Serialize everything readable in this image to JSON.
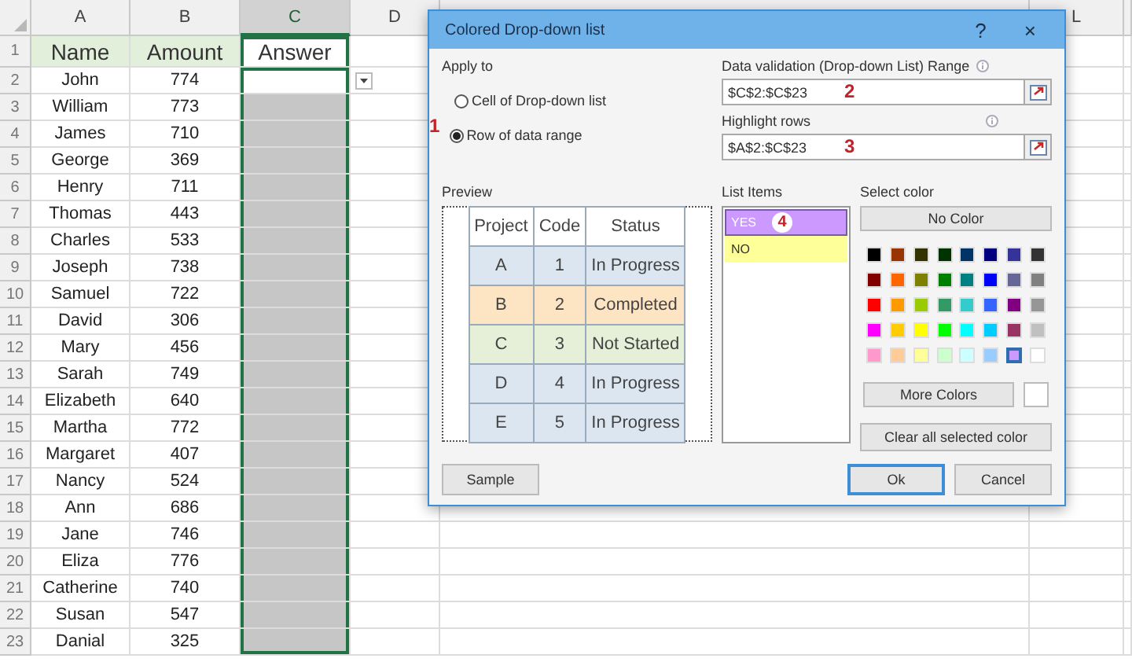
{
  "sheet": {
    "columns": [
      {
        "label": "A",
        "selected": false
      },
      {
        "label": "B",
        "selected": false
      },
      {
        "label": "C",
        "selected": true
      },
      {
        "label": "D",
        "selected": false
      },
      {
        "label": "L",
        "selected": false
      }
    ],
    "header_row": {
      "number": "1",
      "cells": [
        "Name",
        "Amount",
        "Answer"
      ]
    },
    "rows": [
      {
        "number": "2",
        "name": "John",
        "amount": "774",
        "active": true
      },
      {
        "number": "3",
        "name": "William",
        "amount": "773",
        "active": false
      },
      {
        "number": "4",
        "name": "James",
        "amount": "710",
        "active": false
      },
      {
        "number": "5",
        "name": "George",
        "amount": "369",
        "active": false
      },
      {
        "number": "6",
        "name": "Henry",
        "amount": "711",
        "active": false
      },
      {
        "number": "7",
        "name": "Thomas",
        "amount": "443",
        "active": false
      },
      {
        "number": "8",
        "name": "Charles",
        "amount": "533",
        "active": false
      },
      {
        "number": "9",
        "name": "Joseph",
        "amount": "738",
        "active": false
      },
      {
        "number": "10",
        "name": "Samuel",
        "amount": "722",
        "active": false
      },
      {
        "number": "11",
        "name": "David",
        "amount": "306",
        "active": false
      },
      {
        "number": "12",
        "name": "Mary",
        "amount": "456",
        "active": false
      },
      {
        "number": "13",
        "name": "Sarah",
        "amount": "749",
        "active": false
      },
      {
        "number": "14",
        "name": "Elizabeth",
        "amount": "640",
        "active": false
      },
      {
        "number": "15",
        "name": "Martha",
        "amount": "772",
        "active": false
      },
      {
        "number": "16",
        "name": "Margaret",
        "amount": "407",
        "active": false
      },
      {
        "number": "17",
        "name": "Nancy",
        "amount": "524",
        "active": false
      },
      {
        "number": "18",
        "name": "Ann",
        "amount": "686",
        "active": false
      },
      {
        "number": "19",
        "name": "Jane",
        "amount": "746",
        "active": false
      },
      {
        "number": "20",
        "name": "Eliza",
        "amount": "776",
        "active": false
      },
      {
        "number": "21",
        "name": "Catherine",
        "amount": "740",
        "active": false
      },
      {
        "number": "22",
        "name": "Susan",
        "amount": "547",
        "active": false
      },
      {
        "number": "23",
        "name": "Danial",
        "amount": "325",
        "active": false
      }
    ]
  },
  "dialog": {
    "title": "Colored Drop-down list",
    "help": "?",
    "close": "×",
    "apply_to": {
      "label": "Apply to",
      "options": [
        {
          "label": "Cell of Drop-down list",
          "selected": false
        },
        {
          "label": "Row of data range",
          "selected": true,
          "annotation": "1"
        }
      ]
    },
    "validation_range": {
      "label": "Data validation (Drop-down List) Range",
      "value": "$C$2:$C$23",
      "annotation": "2"
    },
    "highlight_rows": {
      "label": "Highlight rows",
      "value": "$A$2:$C$23",
      "annotation": "3"
    },
    "preview": {
      "label": "Preview",
      "columns": [
        "Project",
        "Code",
        "Status"
      ],
      "rows": [
        {
          "cells": [
            "A",
            "1",
            "In Progress"
          ],
          "color": "#dce6f1"
        },
        {
          "cells": [
            "B",
            "2",
            "Completed"
          ],
          "color": "#fde4c2"
        },
        {
          "cells": [
            "C",
            "3",
            "Not Started"
          ],
          "color": "#e6efd8"
        },
        {
          "cells": [
            "D",
            "4",
            "In Progress"
          ],
          "color": "#dce6f1"
        },
        {
          "cells": [
            "E",
            "5",
            "In Progress"
          ],
          "color": "#dce6f1"
        }
      ]
    },
    "list_items": {
      "label": "List Items",
      "items": [
        {
          "label": "YES",
          "color": "#cc99ff",
          "selected": true,
          "annotation": "4"
        },
        {
          "label": "NO",
          "color": "#ffff99",
          "selected": false
        }
      ]
    },
    "select_color": {
      "label": "Select color",
      "no_color": "No Color",
      "more_colors": "More Colors",
      "clear": "Clear all selected color",
      "swatches": [
        {
          "color": "#000000",
          "selected": false
        },
        {
          "color": "#993300",
          "selected": false
        },
        {
          "color": "#333300",
          "selected": false
        },
        {
          "color": "#003300",
          "selected": false
        },
        {
          "color": "#003366",
          "selected": false
        },
        {
          "color": "#000080",
          "selected": false
        },
        {
          "color": "#333399",
          "selected": false
        },
        {
          "color": "#333333",
          "selected": false
        },
        {
          "color": "#800000",
          "selected": false
        },
        {
          "color": "#ff6600",
          "selected": false
        },
        {
          "color": "#808000",
          "selected": false
        },
        {
          "color": "#008000",
          "selected": false
        },
        {
          "color": "#008080",
          "selected": false
        },
        {
          "color": "#0000ff",
          "selected": false
        },
        {
          "color": "#666699",
          "selected": false
        },
        {
          "color": "#808080",
          "selected": false
        },
        {
          "color": "#ff0000",
          "selected": false
        },
        {
          "color": "#ff9900",
          "selected": false
        },
        {
          "color": "#99cc00",
          "selected": false
        },
        {
          "color": "#339966",
          "selected": false
        },
        {
          "color": "#33cccc",
          "selected": false
        },
        {
          "color": "#3366ff",
          "selected": false
        },
        {
          "color": "#800080",
          "selected": false
        },
        {
          "color": "#969696",
          "selected": false
        },
        {
          "color": "#ff00ff",
          "selected": false
        },
        {
          "color": "#ffcc00",
          "selected": false
        },
        {
          "color": "#ffff00",
          "selected": false
        },
        {
          "color": "#00ff00",
          "selected": false
        },
        {
          "color": "#00ffff",
          "selected": false
        },
        {
          "color": "#00ccff",
          "selected": false
        },
        {
          "color": "#993366",
          "selected": false
        },
        {
          "color": "#c0c0c0",
          "selected": false
        },
        {
          "color": "#ff99cc",
          "selected": false
        },
        {
          "color": "#ffcc99",
          "selected": false
        },
        {
          "color": "#ffff99",
          "selected": false
        },
        {
          "color": "#ccffcc",
          "selected": false
        },
        {
          "color": "#ccffff",
          "selected": false
        },
        {
          "color": "#99ccff",
          "selected": false
        },
        {
          "color": "#cc99ff",
          "selected": true
        },
        {
          "color": "#ffffff",
          "selected": false
        }
      ]
    },
    "buttons": {
      "sample": "Sample",
      "ok": "Ok",
      "cancel": "Cancel"
    }
  }
}
